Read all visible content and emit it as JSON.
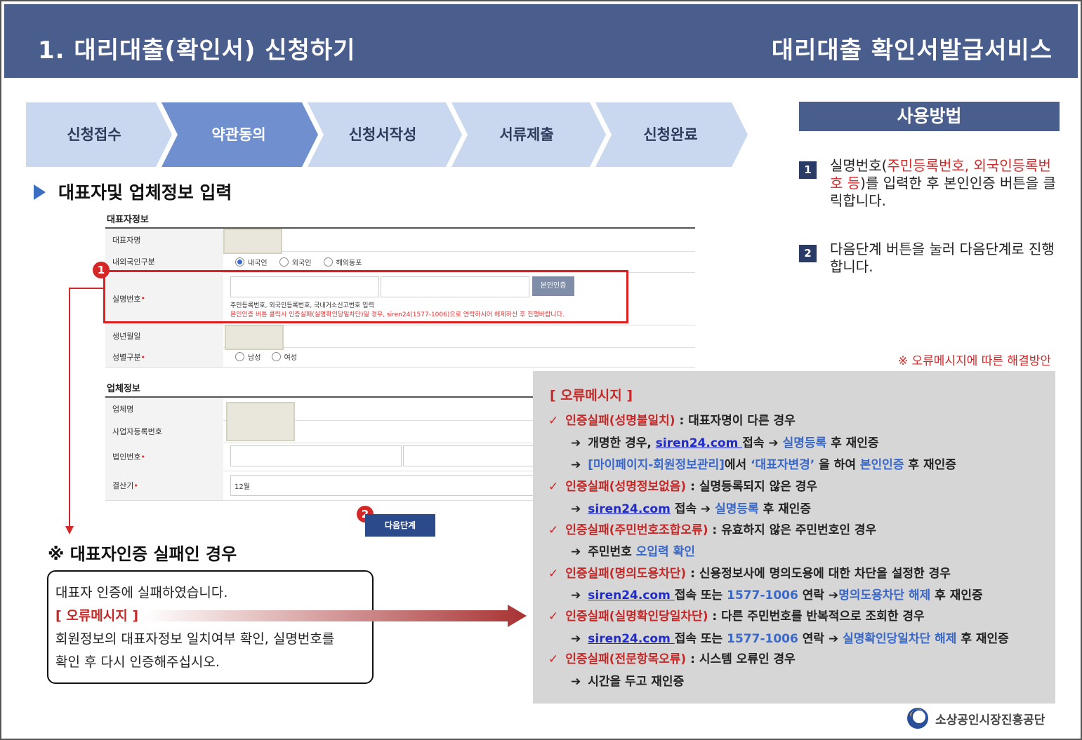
{
  "header": {
    "title_left": "1. 대리대출(확인서) 신청하기",
    "title_right": "대리대출 확인서발급서비스"
  },
  "steps": [
    {
      "label": "신청접수",
      "active": false
    },
    {
      "label": "약관동의",
      "active": true
    },
    {
      "label": "신청서작성",
      "active": false
    },
    {
      "label": "서류제출",
      "active": false
    },
    {
      "label": "신청완료",
      "active": false
    }
  ],
  "section_title": "대표자및 업체정보 입력",
  "form": {
    "rep_group": "대표자정보",
    "rep_name_label": "대표자명",
    "nationality_label": "내외국인구분",
    "nationality_options": [
      "내국인",
      "외국인",
      "해외동포"
    ],
    "id_label": "실명번호",
    "verify_button": "본인인증",
    "id_help": "주민등록번호, 외국인등록번호, 국내거소신고번호 입력",
    "id_warning": "본인인증 버튼 클릭시 인증실패(실명확인당일차단)일 경우, siren24(1577-1006)으로 연락하시어 해제하신 후 진행바랍니다.",
    "birth_label": "생년월일",
    "gender_label": "성별구분",
    "gender_options": [
      "남성",
      "여성"
    ],
    "company_group": "업체정보",
    "company_name_label": "업체명",
    "biz_no_label": "사업자등록번호",
    "corp_no_label": "법인번호",
    "fiscal_label": "결산기",
    "fiscal_value": "12월",
    "next_button": "다음단계",
    "marker_1": "1",
    "marker_2": "2"
  },
  "fail_case": {
    "title": "※ 대표자인증 실패인 경우",
    "line1": "대표자 인증에 실패하였습니다.",
    "error_label": "[ 오류메시지 ]",
    "line2": "회원정보의 대표자정보 일치여부 확인, 실명번호를",
    "line3": "확인 후 다시 인증해주십시오."
  },
  "usage": {
    "title": "사용방법",
    "step1_num": "1",
    "step1_pre": "실명번호(",
    "step1_red": "주민등록번호, 외국인등록번호 등",
    "step1_post": ")를 입력한 후 본인인증 버튼을 클릭합니다.",
    "step2_num": "2",
    "step2_text": "다음단계 버튼을 눌러 다음단계로 진행합니다."
  },
  "note": "※ 오류메시지에 따른 해결방안",
  "errors": {
    "head": "[ 오류메시지 ]",
    "e1_red": "인증실패(성명불일치)",
    "e1_text": " : 대표자명이 다른 경우",
    "e1a_pre": "개명한 경우, ",
    "e1a_link": "siren24.com ",
    "e1a_mid": "접속 ➔ ",
    "e1a_blue": "실명등록",
    "e1a_post": " 후 재인증",
    "e1b_blue": "[마이페이지-회원정보관리]",
    "e1b_mid": "에서 ",
    "e1b_blue2": "‘대표자변경’",
    "e1b_mid2": " 을 하여 ",
    "e1b_blue3": "본인인증",
    "e1b_post": " 후 재인증",
    "e2_red": "인증실패(성명정보없음)",
    "e2_text": " : 실명등록되지 않은 경우",
    "e2a_link": "siren24.com",
    "e2a_mid": " 접속 ➔ ",
    "e2a_blue": "실명등록",
    "e2a_post": " 후 재인증",
    "e3_red": "인증실패(주민번호조합오류)",
    "e3_text": " : 유효하지 않은 주민번호인 경우",
    "e3a_pre": "주민번호 ",
    "e3a_blue": "오입력 확인",
    "e4_red": "인증실패(명의도용차단)",
    "e4_text": " :  신용정보사에 명의도용에 대한 차단을 설정한 경우",
    "e4a_link": "siren24.com ",
    "e4a_mid": "접속 또는 ",
    "e4a_blue": "1577-1006",
    "e4a_mid2": " 연락 ➔",
    "e4a_blue2": "명의도용차단 해제",
    "e4a_post": " 후 재인증",
    "e5_red": "인증실패(실명확인당일차단)",
    "e5_text": " : 다른 주민번호를 반복적으로 조회한 경우",
    "e5a_link": "siren24.com ",
    "e5a_mid": "접속 또는 ",
    "e5a_blue": "1577-1006",
    "e5a_mid2": " 연락 ➔ ",
    "e5a_blue2": "실명확인당일차단 해제",
    "e5a_post": " 후 재인증",
    "e6_red": "인증실패(전문항목오류)",
    "e6_text": " : 시스템 오류인 경우",
    "e6a_text": "시간을 두고 재인증"
  },
  "logo": {
    "name": "소상공인시장진흥공단"
  },
  "colors": {
    "header_bg": "#4a5e8e",
    "step_inactive": "#c9d8ee",
    "step_active": "#6f8fcf",
    "accent_red": "#c62828",
    "accent_blue": "#3a68c9",
    "error_panel_bg": "#d6d6d6"
  }
}
